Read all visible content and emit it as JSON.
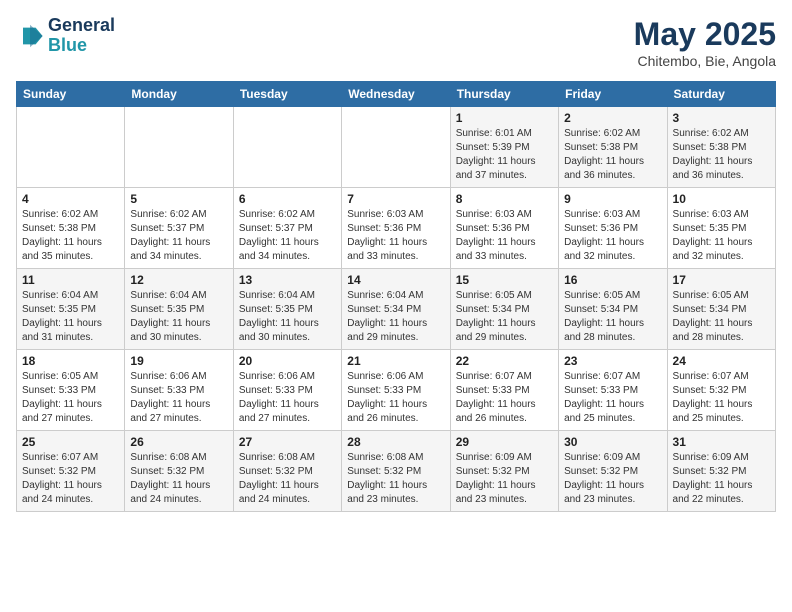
{
  "header": {
    "logo_line1": "General",
    "logo_line2": "Blue",
    "month": "May 2025",
    "location": "Chitembo, Bie, Angola"
  },
  "weekdays": [
    "Sunday",
    "Monday",
    "Tuesday",
    "Wednesday",
    "Thursday",
    "Friday",
    "Saturday"
  ],
  "weeks": [
    [
      {
        "day": "",
        "info": ""
      },
      {
        "day": "",
        "info": ""
      },
      {
        "day": "",
        "info": ""
      },
      {
        "day": "",
        "info": ""
      },
      {
        "day": "1",
        "info": "Sunrise: 6:01 AM\nSunset: 5:39 PM\nDaylight: 11 hours\nand 37 minutes."
      },
      {
        "day": "2",
        "info": "Sunrise: 6:02 AM\nSunset: 5:38 PM\nDaylight: 11 hours\nand 36 minutes."
      },
      {
        "day": "3",
        "info": "Sunrise: 6:02 AM\nSunset: 5:38 PM\nDaylight: 11 hours\nand 36 minutes."
      }
    ],
    [
      {
        "day": "4",
        "info": "Sunrise: 6:02 AM\nSunset: 5:38 PM\nDaylight: 11 hours\nand 35 minutes."
      },
      {
        "day": "5",
        "info": "Sunrise: 6:02 AM\nSunset: 5:37 PM\nDaylight: 11 hours\nand 34 minutes."
      },
      {
        "day": "6",
        "info": "Sunrise: 6:02 AM\nSunset: 5:37 PM\nDaylight: 11 hours\nand 34 minutes."
      },
      {
        "day": "7",
        "info": "Sunrise: 6:03 AM\nSunset: 5:36 PM\nDaylight: 11 hours\nand 33 minutes."
      },
      {
        "day": "8",
        "info": "Sunrise: 6:03 AM\nSunset: 5:36 PM\nDaylight: 11 hours\nand 33 minutes."
      },
      {
        "day": "9",
        "info": "Sunrise: 6:03 AM\nSunset: 5:36 PM\nDaylight: 11 hours\nand 32 minutes."
      },
      {
        "day": "10",
        "info": "Sunrise: 6:03 AM\nSunset: 5:35 PM\nDaylight: 11 hours\nand 32 minutes."
      }
    ],
    [
      {
        "day": "11",
        "info": "Sunrise: 6:04 AM\nSunset: 5:35 PM\nDaylight: 11 hours\nand 31 minutes."
      },
      {
        "day": "12",
        "info": "Sunrise: 6:04 AM\nSunset: 5:35 PM\nDaylight: 11 hours\nand 30 minutes."
      },
      {
        "day": "13",
        "info": "Sunrise: 6:04 AM\nSunset: 5:35 PM\nDaylight: 11 hours\nand 30 minutes."
      },
      {
        "day": "14",
        "info": "Sunrise: 6:04 AM\nSunset: 5:34 PM\nDaylight: 11 hours\nand 29 minutes."
      },
      {
        "day": "15",
        "info": "Sunrise: 6:05 AM\nSunset: 5:34 PM\nDaylight: 11 hours\nand 29 minutes."
      },
      {
        "day": "16",
        "info": "Sunrise: 6:05 AM\nSunset: 5:34 PM\nDaylight: 11 hours\nand 28 minutes."
      },
      {
        "day": "17",
        "info": "Sunrise: 6:05 AM\nSunset: 5:34 PM\nDaylight: 11 hours\nand 28 minutes."
      }
    ],
    [
      {
        "day": "18",
        "info": "Sunrise: 6:05 AM\nSunset: 5:33 PM\nDaylight: 11 hours\nand 27 minutes."
      },
      {
        "day": "19",
        "info": "Sunrise: 6:06 AM\nSunset: 5:33 PM\nDaylight: 11 hours\nand 27 minutes."
      },
      {
        "day": "20",
        "info": "Sunrise: 6:06 AM\nSunset: 5:33 PM\nDaylight: 11 hours\nand 27 minutes."
      },
      {
        "day": "21",
        "info": "Sunrise: 6:06 AM\nSunset: 5:33 PM\nDaylight: 11 hours\nand 26 minutes."
      },
      {
        "day": "22",
        "info": "Sunrise: 6:07 AM\nSunset: 5:33 PM\nDaylight: 11 hours\nand 26 minutes."
      },
      {
        "day": "23",
        "info": "Sunrise: 6:07 AM\nSunset: 5:33 PM\nDaylight: 11 hours\nand 25 minutes."
      },
      {
        "day": "24",
        "info": "Sunrise: 6:07 AM\nSunset: 5:32 PM\nDaylight: 11 hours\nand 25 minutes."
      }
    ],
    [
      {
        "day": "25",
        "info": "Sunrise: 6:07 AM\nSunset: 5:32 PM\nDaylight: 11 hours\nand 24 minutes."
      },
      {
        "day": "26",
        "info": "Sunrise: 6:08 AM\nSunset: 5:32 PM\nDaylight: 11 hours\nand 24 minutes."
      },
      {
        "day": "27",
        "info": "Sunrise: 6:08 AM\nSunset: 5:32 PM\nDaylight: 11 hours\nand 24 minutes."
      },
      {
        "day": "28",
        "info": "Sunrise: 6:08 AM\nSunset: 5:32 PM\nDaylight: 11 hours\nand 23 minutes."
      },
      {
        "day": "29",
        "info": "Sunrise: 6:09 AM\nSunset: 5:32 PM\nDaylight: 11 hours\nand 23 minutes."
      },
      {
        "day": "30",
        "info": "Sunrise: 6:09 AM\nSunset: 5:32 PM\nDaylight: 11 hours\nand 23 minutes."
      },
      {
        "day": "31",
        "info": "Sunrise: 6:09 AM\nSunset: 5:32 PM\nDaylight: 11 hours\nand 22 minutes."
      }
    ]
  ]
}
